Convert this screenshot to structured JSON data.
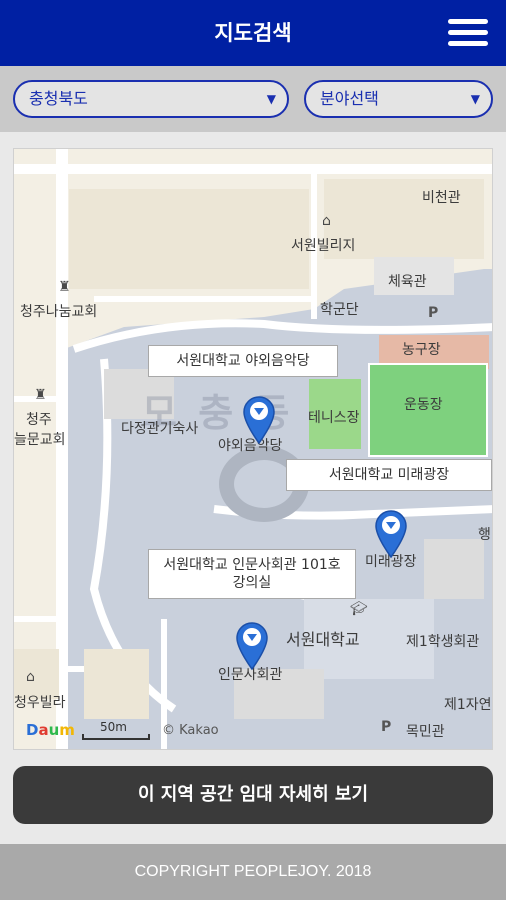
{
  "header": {
    "title": "지도검색",
    "menu_icon": "hamburger-menu-icon"
  },
  "filters": {
    "region": {
      "selected": "충청북도",
      "arrow": "▼"
    },
    "field": {
      "selected": "분야선택",
      "arrow": "▼"
    }
  },
  "map": {
    "watermark": "모 충 동",
    "labels": {
      "bicheongwan": "비천관",
      "seowon_villa": "서원빌리지",
      "gymnasium": "체육관",
      "hakgundan": "학군단",
      "basketball": "농구장",
      "tennis": "테니스장",
      "playground": "운동장",
      "church": "청주나눔교회",
      "church2_line1": "청주",
      "church2_line2": "늘문교회",
      "dajeong": "다정관기숙사",
      "outdoor_short": "야외음악당",
      "mirae_short": "미래광장",
      "seowon_univ": "서원대학교",
      "student_hall": "제1학생회관",
      "inmun_short": "인문사회관",
      "jayeon": "제1자연",
      "mokmin": "목민관",
      "haeng": "행",
      "villa": "청우빌라",
      "parking": "P"
    },
    "callouts": {
      "outdoor": "서원대학교 야외음악당",
      "mirae": "서원대학교 미래광장",
      "inmun": "서원대학교 인문사회관 101호 강의실"
    },
    "scale_text": "50m",
    "attribution": "© Kakao",
    "logo": "Daum"
  },
  "detail_button": "이 지역 공간 임대 자세히 보기",
  "footer": "COPYRIGHT PEOPLEJOY. 2018",
  "colors": {
    "header": "#0020a3",
    "marker": "#2a6fd6",
    "button": "#3a3a3a"
  }
}
